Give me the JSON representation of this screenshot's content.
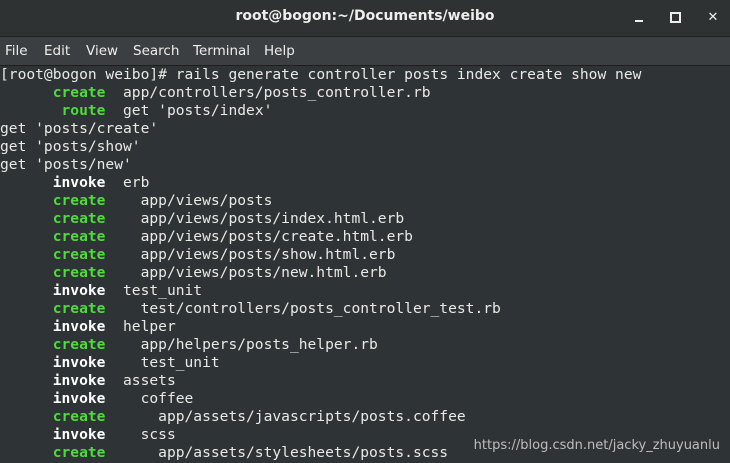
{
  "window": {
    "title": "root@bogon:~/Documents/weibo"
  },
  "menu": {
    "items": [
      "File",
      "Edit",
      "View",
      "Search",
      "Terminal",
      "Help"
    ]
  },
  "terminal": {
    "prompt": "[root@bogon weibo]# ",
    "command": "rails generate controller posts index create show new",
    "lines": [
      {
        "kind": "action",
        "verb": "create",
        "indent": "      ",
        "text": "  app/controllers/posts_controller.rb",
        "color": "green"
      },
      {
        "kind": "action",
        "verb": "route",
        "indent": "       ",
        "text": "  get 'posts/index'",
        "color": "green"
      },
      {
        "kind": "plain",
        "text": "get 'posts/create'"
      },
      {
        "kind": "plain",
        "text": "get 'posts/show'"
      },
      {
        "kind": "plain",
        "text": "get 'posts/new'"
      },
      {
        "kind": "action",
        "verb": "invoke",
        "indent": "      ",
        "text": "  erb",
        "color": "white"
      },
      {
        "kind": "action",
        "verb": "create",
        "indent": "      ",
        "text": "    app/views/posts",
        "color": "green"
      },
      {
        "kind": "action",
        "verb": "create",
        "indent": "      ",
        "text": "    app/views/posts/index.html.erb",
        "color": "green"
      },
      {
        "kind": "action",
        "verb": "create",
        "indent": "      ",
        "text": "    app/views/posts/create.html.erb",
        "color": "green"
      },
      {
        "kind": "action",
        "verb": "create",
        "indent": "      ",
        "text": "    app/views/posts/show.html.erb",
        "color": "green"
      },
      {
        "kind": "action",
        "verb": "create",
        "indent": "      ",
        "text": "    app/views/posts/new.html.erb",
        "color": "green"
      },
      {
        "kind": "action",
        "verb": "invoke",
        "indent": "      ",
        "text": "  test_unit",
        "color": "white"
      },
      {
        "kind": "action",
        "verb": "create",
        "indent": "      ",
        "text": "    test/controllers/posts_controller_test.rb",
        "color": "green"
      },
      {
        "kind": "action",
        "verb": "invoke",
        "indent": "      ",
        "text": "  helper",
        "color": "white"
      },
      {
        "kind": "action",
        "verb": "create",
        "indent": "      ",
        "text": "    app/helpers/posts_helper.rb",
        "color": "green"
      },
      {
        "kind": "action",
        "verb": "invoke",
        "indent": "      ",
        "text": "    test_unit",
        "color": "white"
      },
      {
        "kind": "action",
        "verb": "invoke",
        "indent": "      ",
        "text": "  assets",
        "color": "white"
      },
      {
        "kind": "action",
        "verb": "invoke",
        "indent": "      ",
        "text": "    coffee",
        "color": "white"
      },
      {
        "kind": "action",
        "verb": "create",
        "indent": "      ",
        "text": "      app/assets/javascripts/posts.coffee",
        "color": "green"
      },
      {
        "kind": "action",
        "verb": "invoke",
        "indent": "      ",
        "text": "    scss",
        "color": "white"
      },
      {
        "kind": "action",
        "verb": "create",
        "indent": "      ",
        "text": "      app/assets/stylesheets/posts.scss",
        "color": "green"
      }
    ]
  },
  "watermark": "https://blog.csdn.net/jacky_zhuyuanlu",
  "colors": {
    "background": "#2e3436",
    "green": "#4ddc38",
    "text": "#e9e9e6"
  }
}
